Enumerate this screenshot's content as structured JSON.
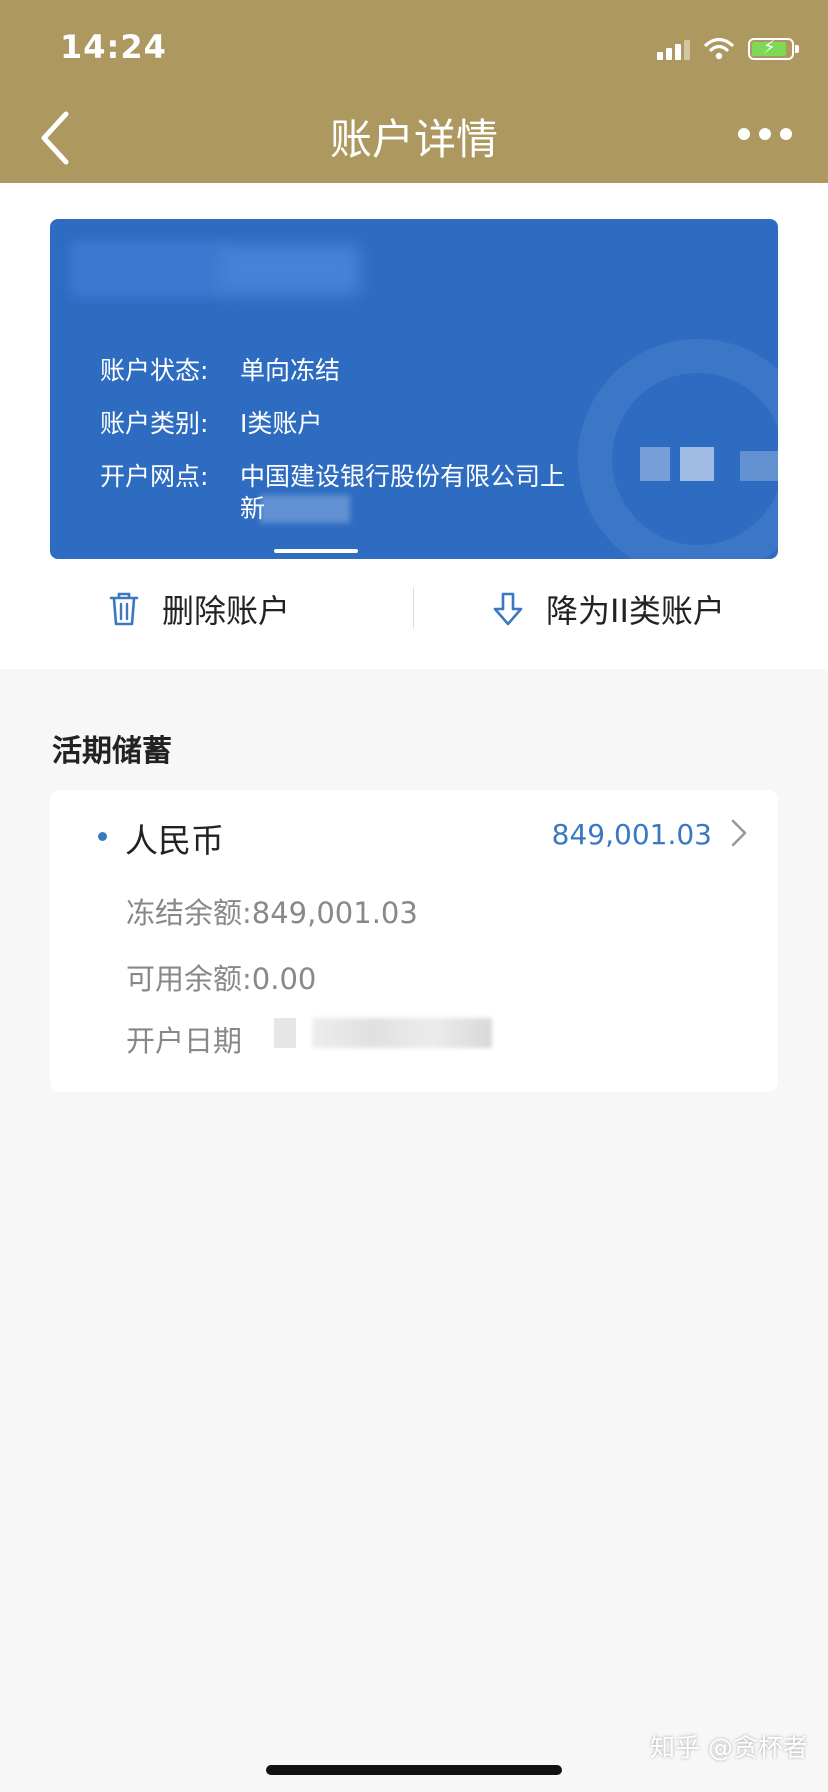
{
  "status_bar": {
    "time": "14:24"
  },
  "nav": {
    "title": "账户详情"
  },
  "card": {
    "rows": [
      {
        "label": "账户状态:",
        "value": "单向冻结"
      },
      {
        "label": "账户类别:",
        "value": "I类账户"
      },
      {
        "label": "开户网点:",
        "value": "中国建设银行股份有限公司上",
        "value2": "新"
      }
    ]
  },
  "actions": {
    "delete_label": "删除账户",
    "downgrade_label": "降为II类账户"
  },
  "section": {
    "title": "活期储蓄"
  },
  "account": {
    "currency": "人民币",
    "amount": "849,001.03",
    "frozen_label": "冻结余额:",
    "frozen_value": "849,001.03",
    "available_label": "可用余额:",
    "available_value": "0.00",
    "open_date_label": "开户日期"
  },
  "watermark": "知乎 @贪杯者",
  "colors": {
    "header": "#ad9860",
    "card": "#2e6cc2",
    "accent": "#3a78c2"
  }
}
